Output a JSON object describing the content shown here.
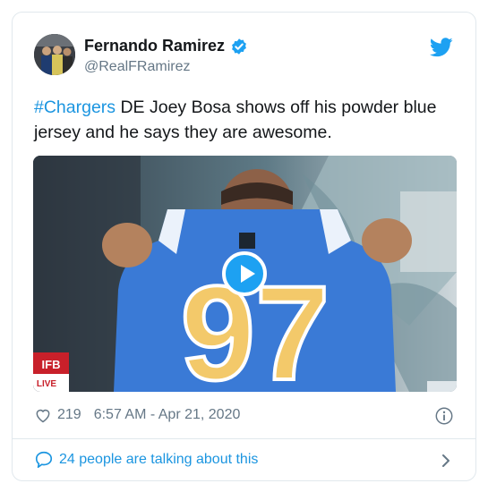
{
  "author": {
    "display_name": "Fernando Ramirez",
    "handle": "@RealFRamirez"
  },
  "tweet": {
    "hashtag": "#Chargers",
    "text": " DE Joey Bosa shows off his powder blue jersey and he says they are awesome."
  },
  "media": {
    "jersey_number": "97",
    "badge_top": "IFB",
    "badge_bottom": "LIVE",
    "icon": "play-icon"
  },
  "meta": {
    "likes": "219",
    "timestamp": "6:57 AM - Apr 21, 2020"
  },
  "footer": {
    "talking_label": "24 people are talking about this"
  },
  "colors": {
    "accent": "#1da1f2",
    "link": "#1b95e0",
    "muted": "#657786",
    "jersey": "#3a7ad6",
    "jersey_trim": "#f3c96a"
  }
}
